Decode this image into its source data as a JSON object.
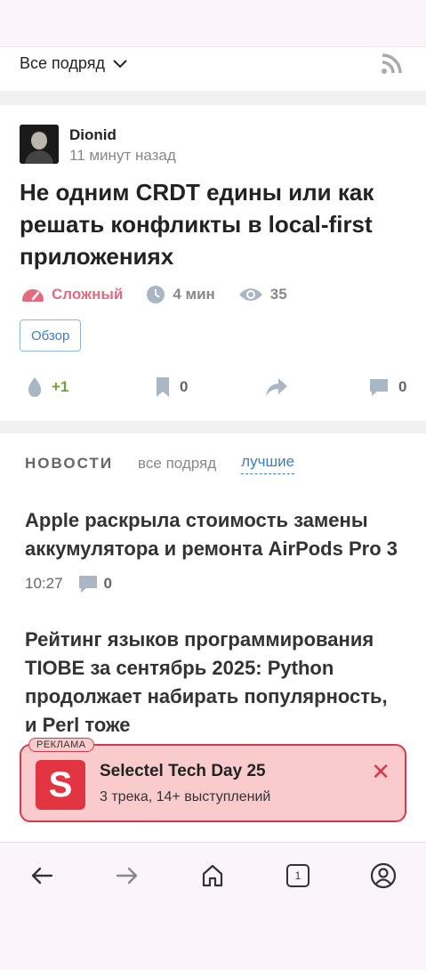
{
  "feed": {
    "filter_label": "Все подряд"
  },
  "article": {
    "author": "Dionid",
    "time": "11 минут назад",
    "title": "Не одним CRDT едины или как решать конфликты в local-first приложениях",
    "difficulty": "Сложный",
    "reading_time": "4 мин",
    "views": "35",
    "tag": "Обзор",
    "votes": "+1",
    "bookmarks": "0",
    "comments": "0"
  },
  "news": {
    "header": "НОВОСТИ",
    "tab_all": "все подряд",
    "tab_best": "лучшие",
    "items": [
      {
        "title": "Apple раскрыла стоимость замены аккумулятора и ремонта AirPods Pro 3",
        "time": "10:27",
        "comments": "0"
      },
      {
        "title": "Рейтинг языков программирования TIOBE за сентябрь 2025: Python продолжает набирать популярность, и Perl тоже"
      }
    ]
  },
  "ad": {
    "label": "РЕКЛАМА",
    "logo_letter": "S",
    "title": "Selectel Tech Day 25",
    "subtitle": "3 трека, 14+ выступлений"
  },
  "nav": {
    "tab_count": "1"
  },
  "colors": {
    "accent": "#3d7fbf",
    "hard": "#e66a7f",
    "positive": "#6aa33a",
    "ad_bg": "#f9cbcd",
    "ad_border": "#d63a4a"
  }
}
